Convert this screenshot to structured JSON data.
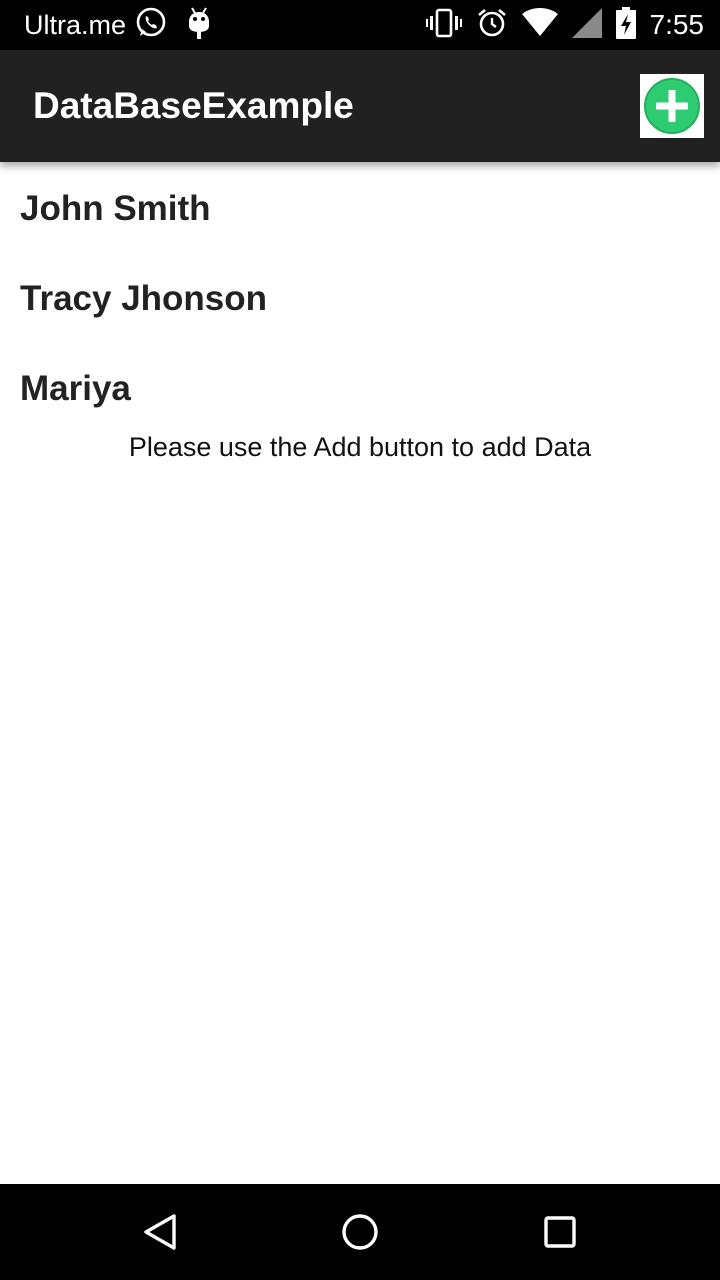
{
  "status_bar": {
    "carrier": "Ultra.me",
    "time": "7:55",
    "left_icons": [
      "whatsapp-icon",
      "android-debug-icon"
    ],
    "right_icons": [
      "vibrate-icon",
      "alarm-icon",
      "wifi-icon",
      "cell-signal-icon",
      "battery-charging-icon"
    ]
  },
  "app_bar": {
    "title": "DataBaseExample",
    "add_icon": "add-circle-icon",
    "accent_color": "#2ecc71"
  },
  "list": {
    "items": [
      {
        "label": "John Smith"
      },
      {
        "label": "Tracy Jhonson"
      },
      {
        "label": "Mariya"
      }
    ]
  },
  "empty_hint": "Please use the Add button to add Data",
  "nav_bar": {
    "icons": [
      "back-icon",
      "home-icon",
      "recents-icon"
    ]
  }
}
